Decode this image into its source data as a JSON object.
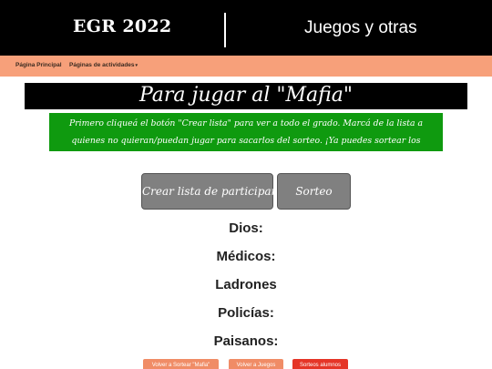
{
  "header": {
    "site_title": "EGR 2022",
    "site_subtitle": "Juegos y otras"
  },
  "nav": {
    "home": "Página Principal",
    "activities": "Páginas de actividades",
    "activities_caret": "▾"
  },
  "game": {
    "title": "Para jugar al \"Mafia\"",
    "instructions": "Primero cliqueá el botón \"Crear lista\" para ver a todo el grado. Marcá de la lista a quienes no quieran/puedan jugar para sacarlos del sorteo. ¡Ya puedes sortear los roles!"
  },
  "buttons": {
    "create_list": "Crear lista de participantes",
    "draw": "Sorteo"
  },
  "roles": {
    "gods": "Dios:",
    "doctors": "Médicos:",
    "thieves": "Ladrones",
    "police": "Policías:",
    "villagers": "Paisanos:"
  },
  "footer_buttons": {
    "back_mafia": "Volver a Sortear \"Mafia\"",
    "back_games": "Volver a Juegos",
    "students": "Sorteos alumnos"
  },
  "colors": {
    "header_bg": "#000000",
    "nav_bg": "#f7a07a",
    "instructions_bg": "#0f9a0f",
    "button_gray": "#808080",
    "button_orange": "#f08c66",
    "button_red": "#e53527"
  }
}
